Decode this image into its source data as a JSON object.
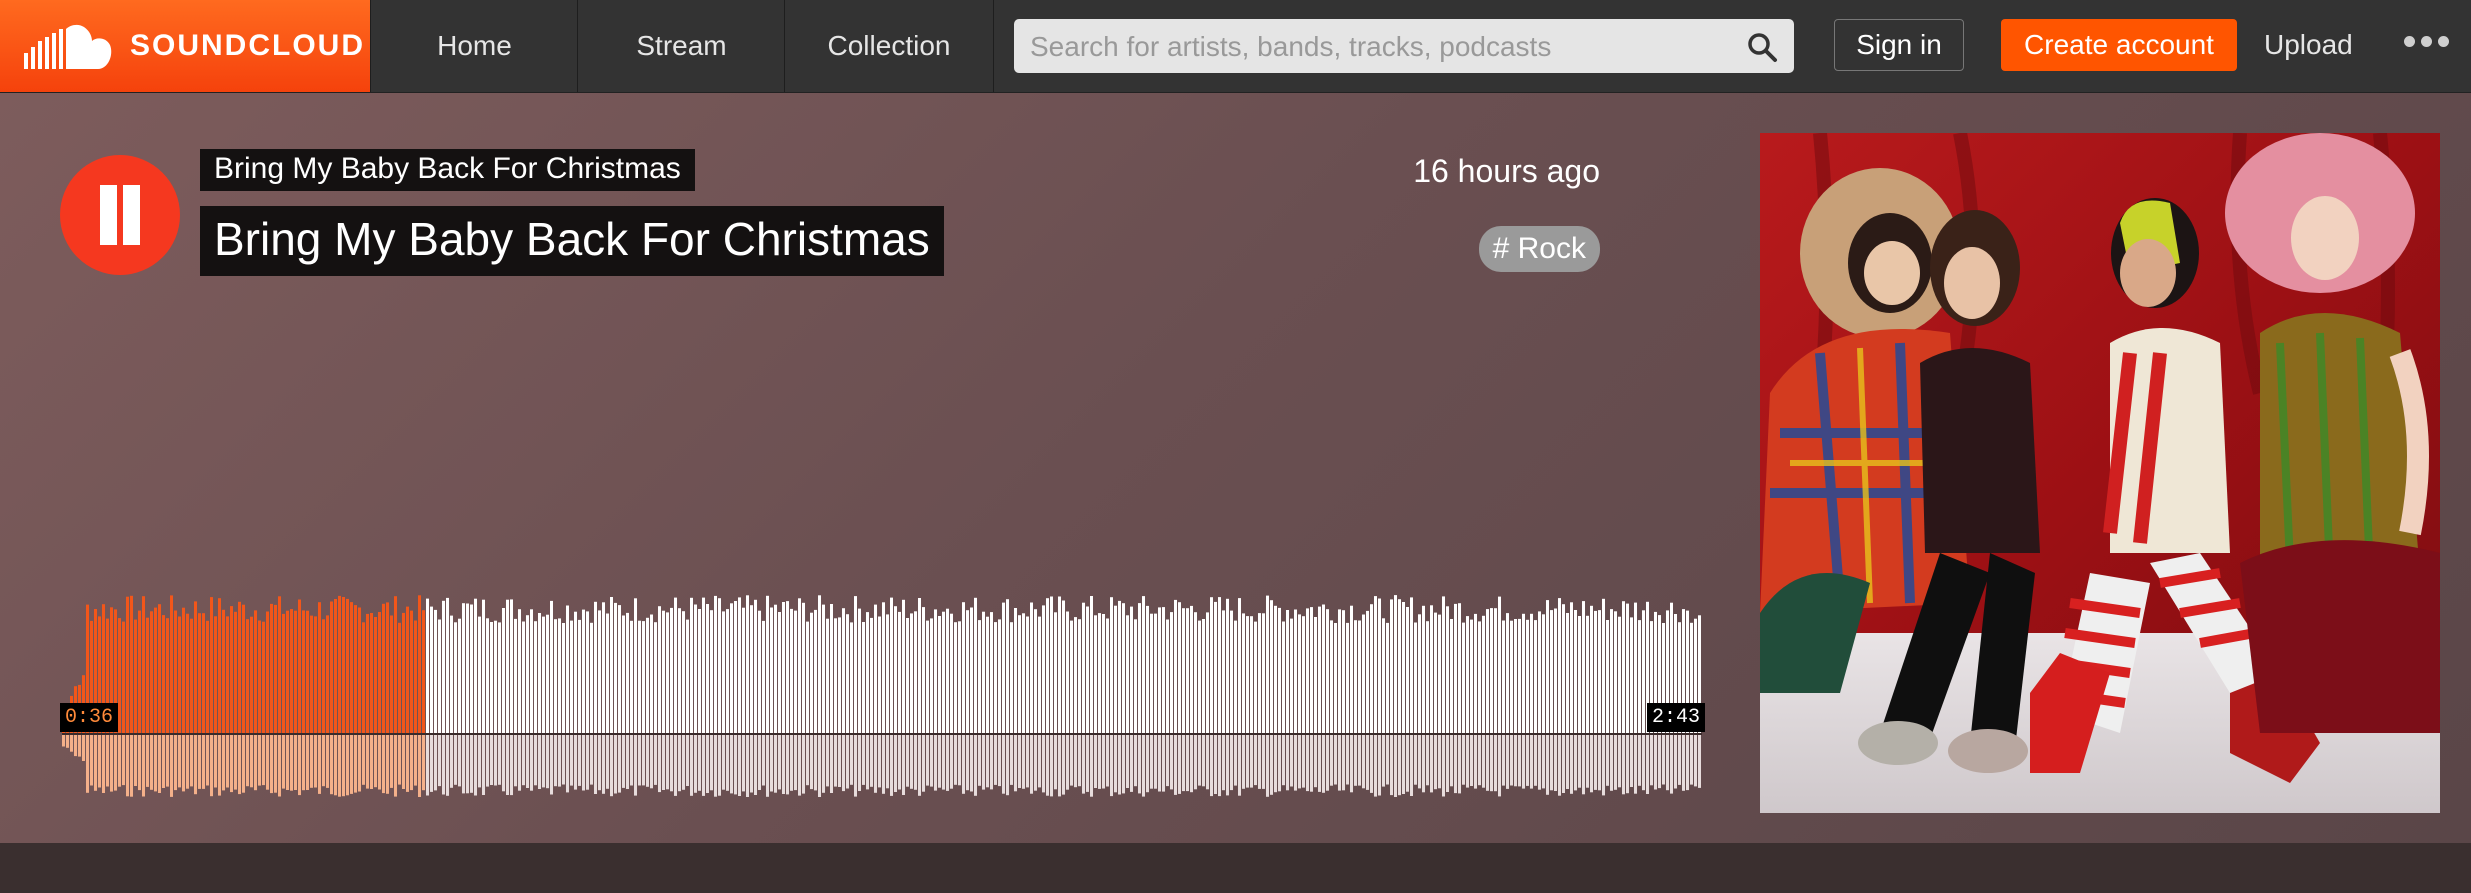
{
  "header": {
    "logo_text": "SOUNDCLOUD",
    "nav": [
      "Home",
      "Stream",
      "Collection"
    ],
    "search_placeholder": "Search for artists, bands, tracks, podcasts",
    "sign_in": "Sign in",
    "create_account": "Create account",
    "upload": "Upload"
  },
  "track": {
    "artist": "Bring My Baby Back For Christmas",
    "title": "Bring My Baby Back For Christmas",
    "posted": "16 hours ago",
    "tag": "# Rock",
    "elapsed": "0:36",
    "duration": "2:43",
    "progress": 0.221,
    "state": "playing"
  },
  "colors": {
    "accent": "#ff5500",
    "played_wave": "#f2561a",
    "unplayed_wave": "#ffffff",
    "hero_bg": "#6e5254"
  },
  "icons": [
    "soundcloud-cloud-icon",
    "search-icon",
    "pause-icon",
    "more-icon"
  ]
}
